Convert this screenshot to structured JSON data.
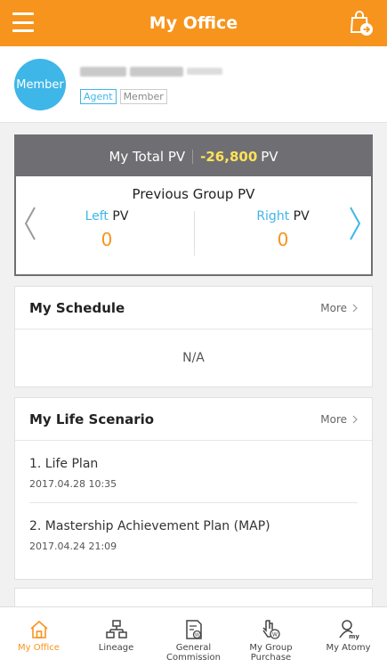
{
  "header": {
    "title": "My Office",
    "menu_icon": "hamburger-menu-icon",
    "cart_icon": "shopping-bag-arrow-icon"
  },
  "profile": {
    "avatar_label": "Member",
    "badges": [
      "Agent",
      "Member"
    ]
  },
  "pv": {
    "total_label": "My Total PV",
    "total_value": "-26,800",
    "total_unit": "PV",
    "group_title": "Previous Group PV",
    "left": {
      "label_accent": "Left",
      "label_rest": " PV",
      "value": "0"
    },
    "right": {
      "label_accent": "Right",
      "label_rest": " PV",
      "value": "0"
    }
  },
  "schedule": {
    "title": "My Schedule",
    "more": "More",
    "empty": "N/A"
  },
  "life": {
    "title": "My Life Scenario",
    "more": "More",
    "items": [
      {
        "title": "1. Life Plan",
        "date": "2017.04.28 10:35"
      },
      {
        "title": "2. Mastership Achievement Plan (MAP)",
        "date": "2017.04.24 21:09"
      }
    ]
  },
  "nav": [
    {
      "label": "My Office",
      "icon": "home-icon",
      "active": true
    },
    {
      "label": "Lineage",
      "icon": "org-chart-icon"
    },
    {
      "label_line1": "General",
      "label_line2": "Commission",
      "icon": "document-won-icon"
    },
    {
      "label_line1": "My Group",
      "label_line2": "Purchase",
      "icon": "hand-coin-icon"
    },
    {
      "label": "My Atomy",
      "icon": "user-my-icon"
    }
  ],
  "colors": {
    "brand_orange": "#f7941d",
    "accent_blue": "#3fb6e8",
    "pv_highlight": "#ffe259",
    "pv_header_gray": "#6f6f73"
  }
}
